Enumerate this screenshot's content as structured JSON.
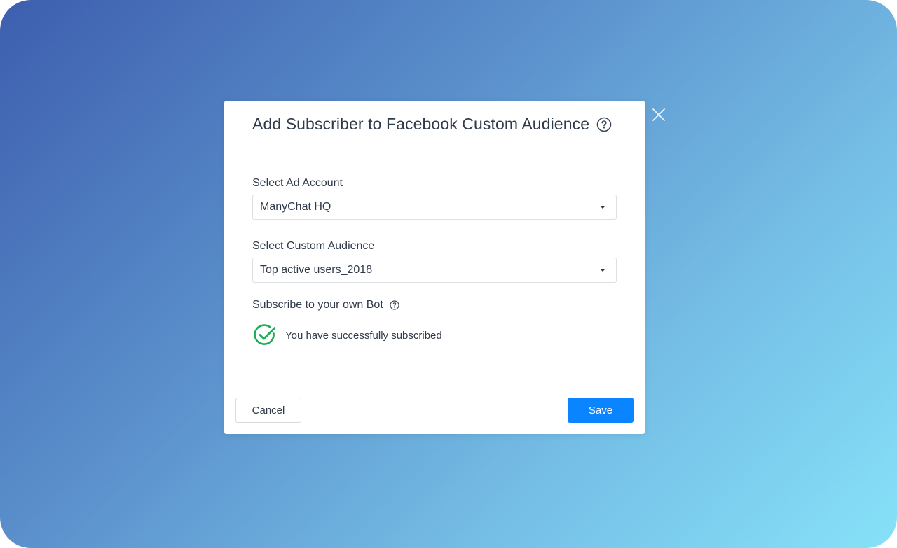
{
  "modal": {
    "title": "Add Subscriber to Facebook Custom Audience",
    "title_help_icon": "question-circle-icon",
    "close_icon": "close-icon"
  },
  "fields": {
    "ad_account": {
      "label": "Select Ad Account",
      "value": "ManyChat HQ"
    },
    "custom_audience": {
      "label": "Select Custom Audience",
      "value": "Top active users_2018"
    }
  },
  "subscribe": {
    "label": "Subscribe to your own Bot",
    "status_text": "You have successfully subscribed",
    "status_icon": "check-circle-icon"
  },
  "footer": {
    "cancel_label": "Cancel",
    "save_label": "Save"
  },
  "colors": {
    "primary": "#0a84ff",
    "success": "#1aae55",
    "text": "#2f3a4a"
  }
}
